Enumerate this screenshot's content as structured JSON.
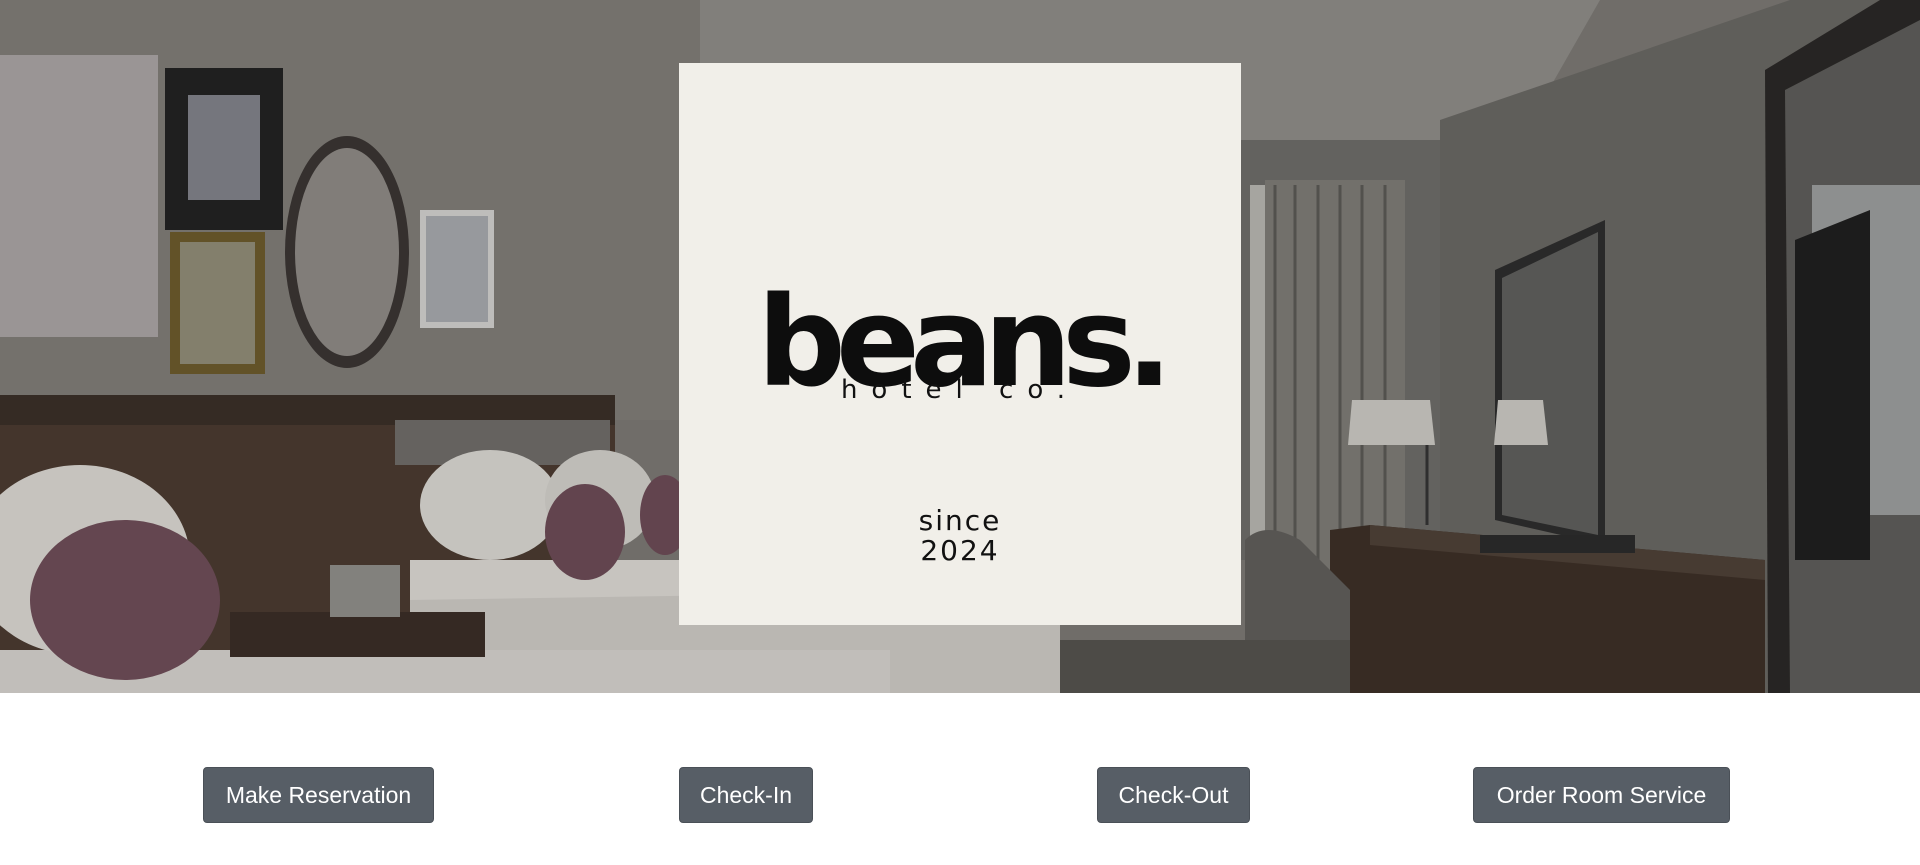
{
  "hero": {
    "image": "hotel-room-photo",
    "logo": {
      "wordmark": "beans.",
      "tagline": "hotel co.",
      "since_label": "since",
      "since_year": "2024",
      "background": "#f1efe9",
      "ink": "#0d0d0d"
    }
  },
  "actions": {
    "make_reservation": "Make Reservation",
    "check_in": "Check-In",
    "check_out": "Check-Out",
    "order_room_service": "Order Room Service",
    "button_color": "#575e66"
  }
}
